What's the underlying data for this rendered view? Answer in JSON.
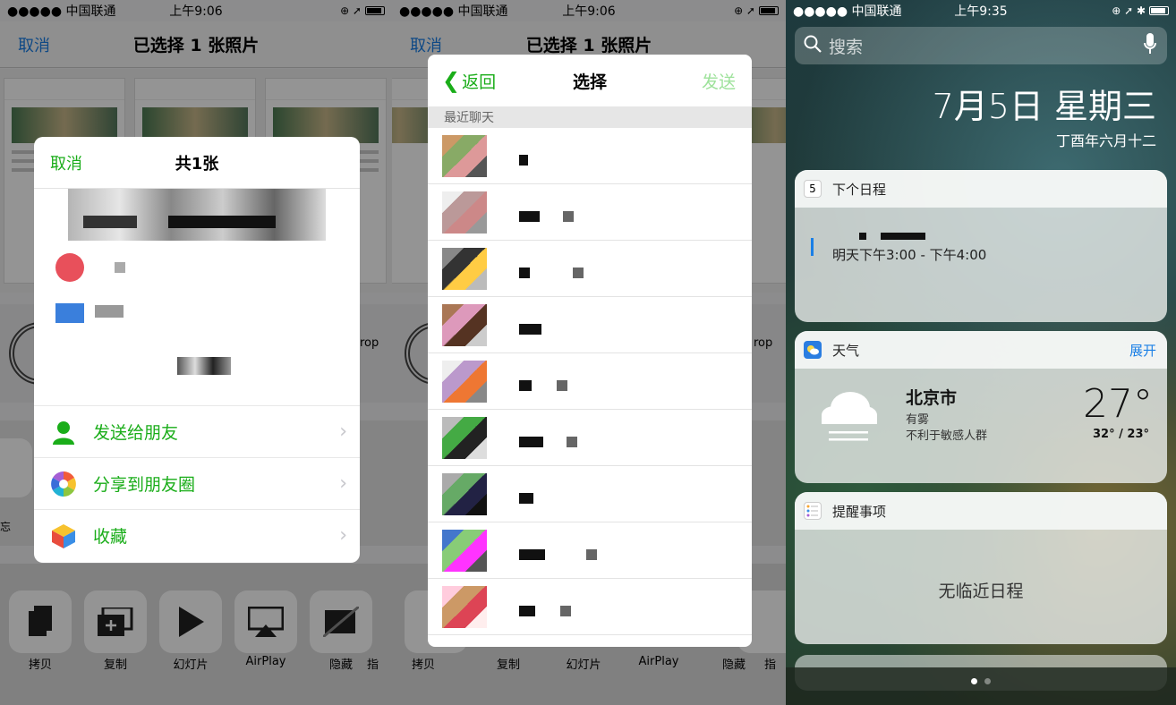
{
  "panel1": {
    "status": {
      "carrier": "●●●●● 中国联通",
      "time": "上午9:06"
    },
    "nav": {
      "cancel": "取消",
      "title": "已选择 1 张照片"
    },
    "side_label_right": "rop",
    "side_label_left": "忘",
    "actions": [
      {
        "label": "拷贝",
        "icon": "copy-icon"
      },
      {
        "label": "复制",
        "icon": "duplicate-icon"
      },
      {
        "label": "幻灯片",
        "icon": "play-icon"
      },
      {
        "label": "AirPlay",
        "icon": "airplay-icon"
      },
      {
        "label": "隐藏",
        "icon": "hide-icon"
      }
    ],
    "action_cutoff": "指",
    "sheet": {
      "cancel": "取消",
      "count": "共1张",
      "options": [
        {
          "label": "发送给朋友",
          "icon": "friend-icon"
        },
        {
          "label": "分享到朋友圈",
          "icon": "moments-icon"
        },
        {
          "label": "收藏",
          "icon": "favorite-icon"
        }
      ]
    }
  },
  "panel2": {
    "status": {
      "carrier": "●●●●● 中国联通",
      "time": "上午9:06"
    },
    "nav": {
      "cancel": "取消",
      "title": "已选择 1 张照片"
    },
    "side_label_right": "rop",
    "modal": {
      "back": "返回",
      "title": "选择",
      "send": "发送",
      "section": "最近聊天",
      "chat_count": 9
    },
    "actions": [
      "拷贝",
      "复制",
      "幻灯片",
      "AirPlay",
      "隐藏"
    ],
    "action_cutoff": "指"
  },
  "panel3": {
    "status": {
      "carrier": "●●●●● 中国联通",
      "time": "上午9:35"
    },
    "search_placeholder": "搜索",
    "date": "7月5日 星期三",
    "lunar": "丁酉年六月十二",
    "calendar": {
      "title": "下个日程",
      "icon_day": "5",
      "event_time": "明天下午3:00 - 下午4:00"
    },
    "weather": {
      "title": "天气",
      "more": "展开",
      "city": "北京市",
      "condition": "有雾",
      "note": "不利于敏感人群",
      "temp": "27°",
      "range": "32° / 23°"
    },
    "reminders": {
      "title": "提醒事项",
      "empty": "无临近日程"
    },
    "colors": {
      "wechat_green": "#1aad19",
      "ios_blue": "#1a7fe6"
    }
  }
}
